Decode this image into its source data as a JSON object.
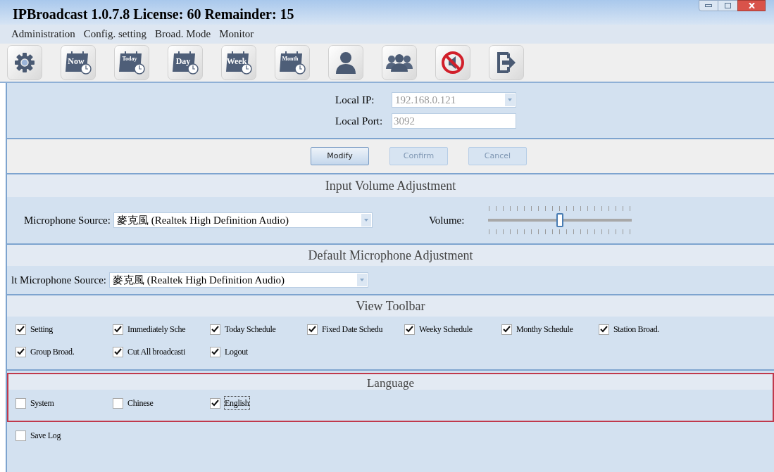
{
  "window": {
    "title": "IPBroadcast 1.0.7.8 License: 60 Remainder: 15"
  },
  "menu": [
    "Administration",
    "Config. setting",
    "Broad. Mode",
    "Monitor"
  ],
  "toolbar": [
    {
      "kind": "gear"
    },
    {
      "kind": "calendar",
      "label": "Now"
    },
    {
      "kind": "calendar",
      "label": "Today"
    },
    {
      "kind": "calendar",
      "label": "Day"
    },
    {
      "kind": "calendar",
      "label": "Week"
    },
    {
      "kind": "calendar",
      "label": "Month"
    },
    {
      "kind": "person"
    },
    {
      "kind": "group"
    },
    {
      "kind": "mute"
    },
    {
      "kind": "logout"
    }
  ],
  "network": {
    "ip_label": "Local IP:",
    "ip": "192.168.0.121",
    "port_label": "Local Port:",
    "port": "3092"
  },
  "buttons": [
    {
      "label": "Modify",
      "disabled": false
    },
    {
      "label": "Confirm",
      "disabled": true
    },
    {
      "label": "Cancel",
      "disabled": true
    }
  ],
  "input_volume": {
    "title": "Input Volume Adjustment",
    "source_label": "Microphone Source:",
    "source": "麥克風 (Realtek High Definition Audio)",
    "volume_label": "Volume:",
    "level": 0.5
  },
  "default_microphone": {
    "title": "Default Microphone Adjustment",
    "source_label": "lt Microphone Source:",
    "source": "麥克風 (Realtek High Definition Audio)"
  },
  "view_toolbar": {
    "title": "View Toolbar",
    "items": [
      {
        "label": "Setting",
        "checked": true
      },
      {
        "label": "Immediately Sche",
        "checked": true
      },
      {
        "label": "Today Schedule",
        "checked": true
      },
      {
        "label": "Fixed Date Schedu",
        "checked": true
      },
      {
        "label": "Weeky Schedule",
        "checked": true
      },
      {
        "label": "Monthy Schedule",
        "checked": true
      },
      {
        "label": "Station Broad.",
        "checked": true
      },
      {
        "label": "Group Broad.",
        "checked": true
      },
      {
        "label": "Cut All broadcasti",
        "checked": true
      },
      {
        "label": "Logout",
        "checked": true
      }
    ]
  },
  "language": {
    "title": "Language",
    "options": [
      {
        "label": "System",
        "checked": false,
        "focused": false
      },
      {
        "label": "Chinese",
        "checked": false,
        "focused": false
      },
      {
        "label": "English",
        "checked": true,
        "focused": true
      }
    ]
  },
  "save_log": {
    "label": "Save Log",
    "checked": false
  }
}
